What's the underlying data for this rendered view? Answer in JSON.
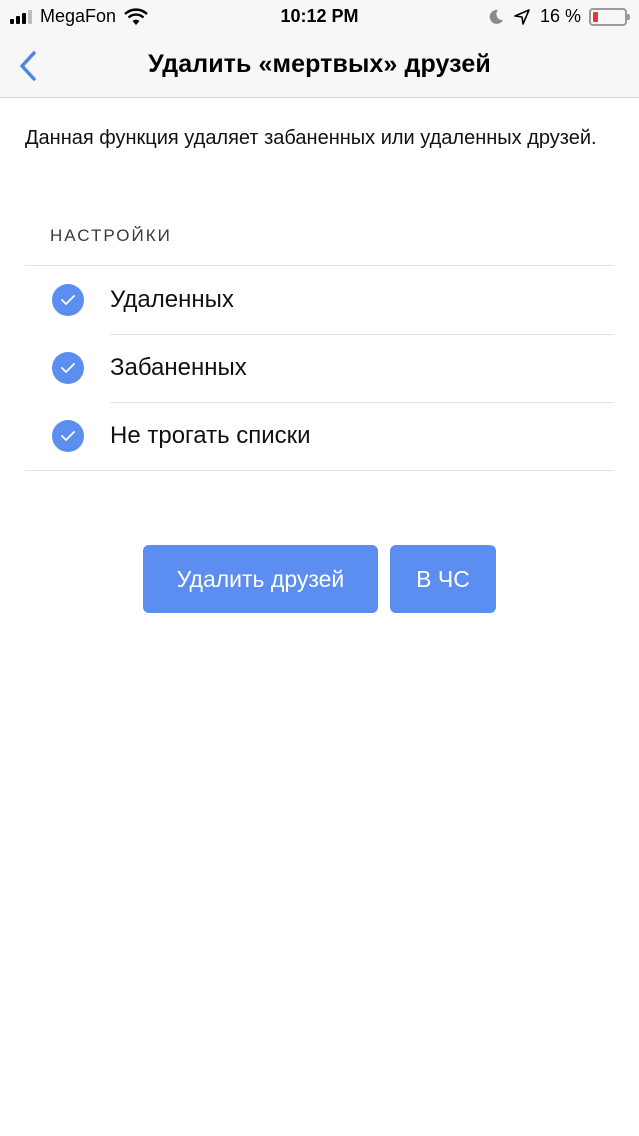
{
  "status_bar": {
    "carrier": "MegaFon",
    "time": "10:12 PM",
    "battery_percent": "16 %",
    "battery_level": 0.16,
    "battery_color": "#e53935",
    "icons": [
      "signal-icon",
      "wifi-icon",
      "moon-icon",
      "location-arrow-icon",
      "battery-icon"
    ]
  },
  "nav": {
    "title": "Удалить «мертвых» друзей",
    "back_icon": "chevron-left-icon",
    "accent": "#4a86e8"
  },
  "description": "Данная функция удаляет забаненных или удаленных друзей.",
  "settings": {
    "header": "НАСТРОЙКИ",
    "items": [
      {
        "label": "Удаленных",
        "checked": true
      },
      {
        "label": "Забаненных",
        "checked": true
      },
      {
        "label": "Не трогать списки",
        "checked": true
      }
    ],
    "check_color": "#5b8ef0"
  },
  "actions": {
    "delete_label": "Удалить друзей",
    "block_label": "В ЧС",
    "button_color": "#5b8ef0"
  }
}
